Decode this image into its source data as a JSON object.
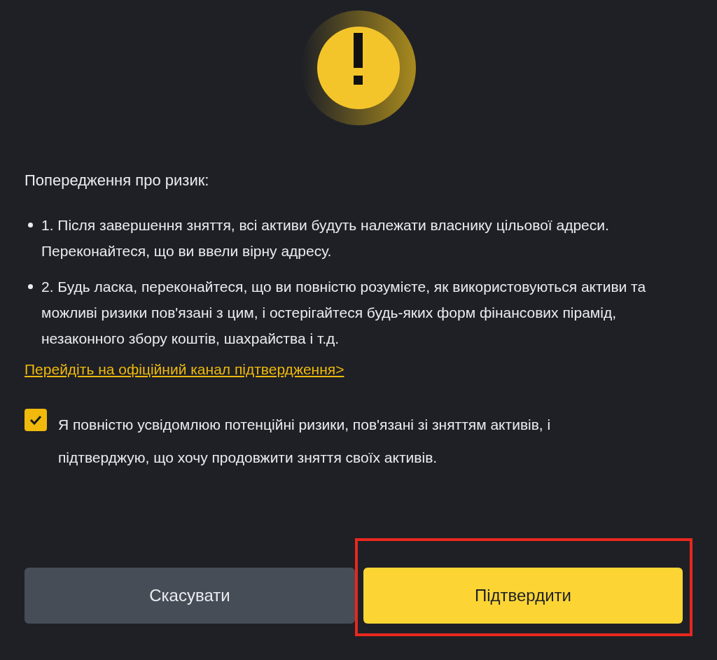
{
  "title": "Попередження про ризик:",
  "items": [
    "1. Після завершення зняття, всі активи будуть належати власнику цільової адреси. Переконайтеся, що ви ввели вірну адресу.",
    "2. Будь ласка, переконайтеся, що ви повністю розумієте, як використовуються активи та можливі ризики пов'язані з цим, і остерігайтеся будь-яких форм фінансових пірамід, незаконного збору коштів, шахрайства і т.д."
  ],
  "link": "Перейдіть на офіційний канал підтвердження>",
  "agreement": {
    "checked": true,
    "label": "Я повністю усвідомлюю потенційні ризики, пов'язані зі зняттям активів, і підтверджую, що хочу продовжити зняття своїх активів."
  },
  "buttons": [
    {
      "kind": "secondary",
      "label": "Скасувати",
      "highlighted": false
    },
    {
      "kind": "primary",
      "label": "Підтвердити",
      "highlighted": true
    }
  ]
}
